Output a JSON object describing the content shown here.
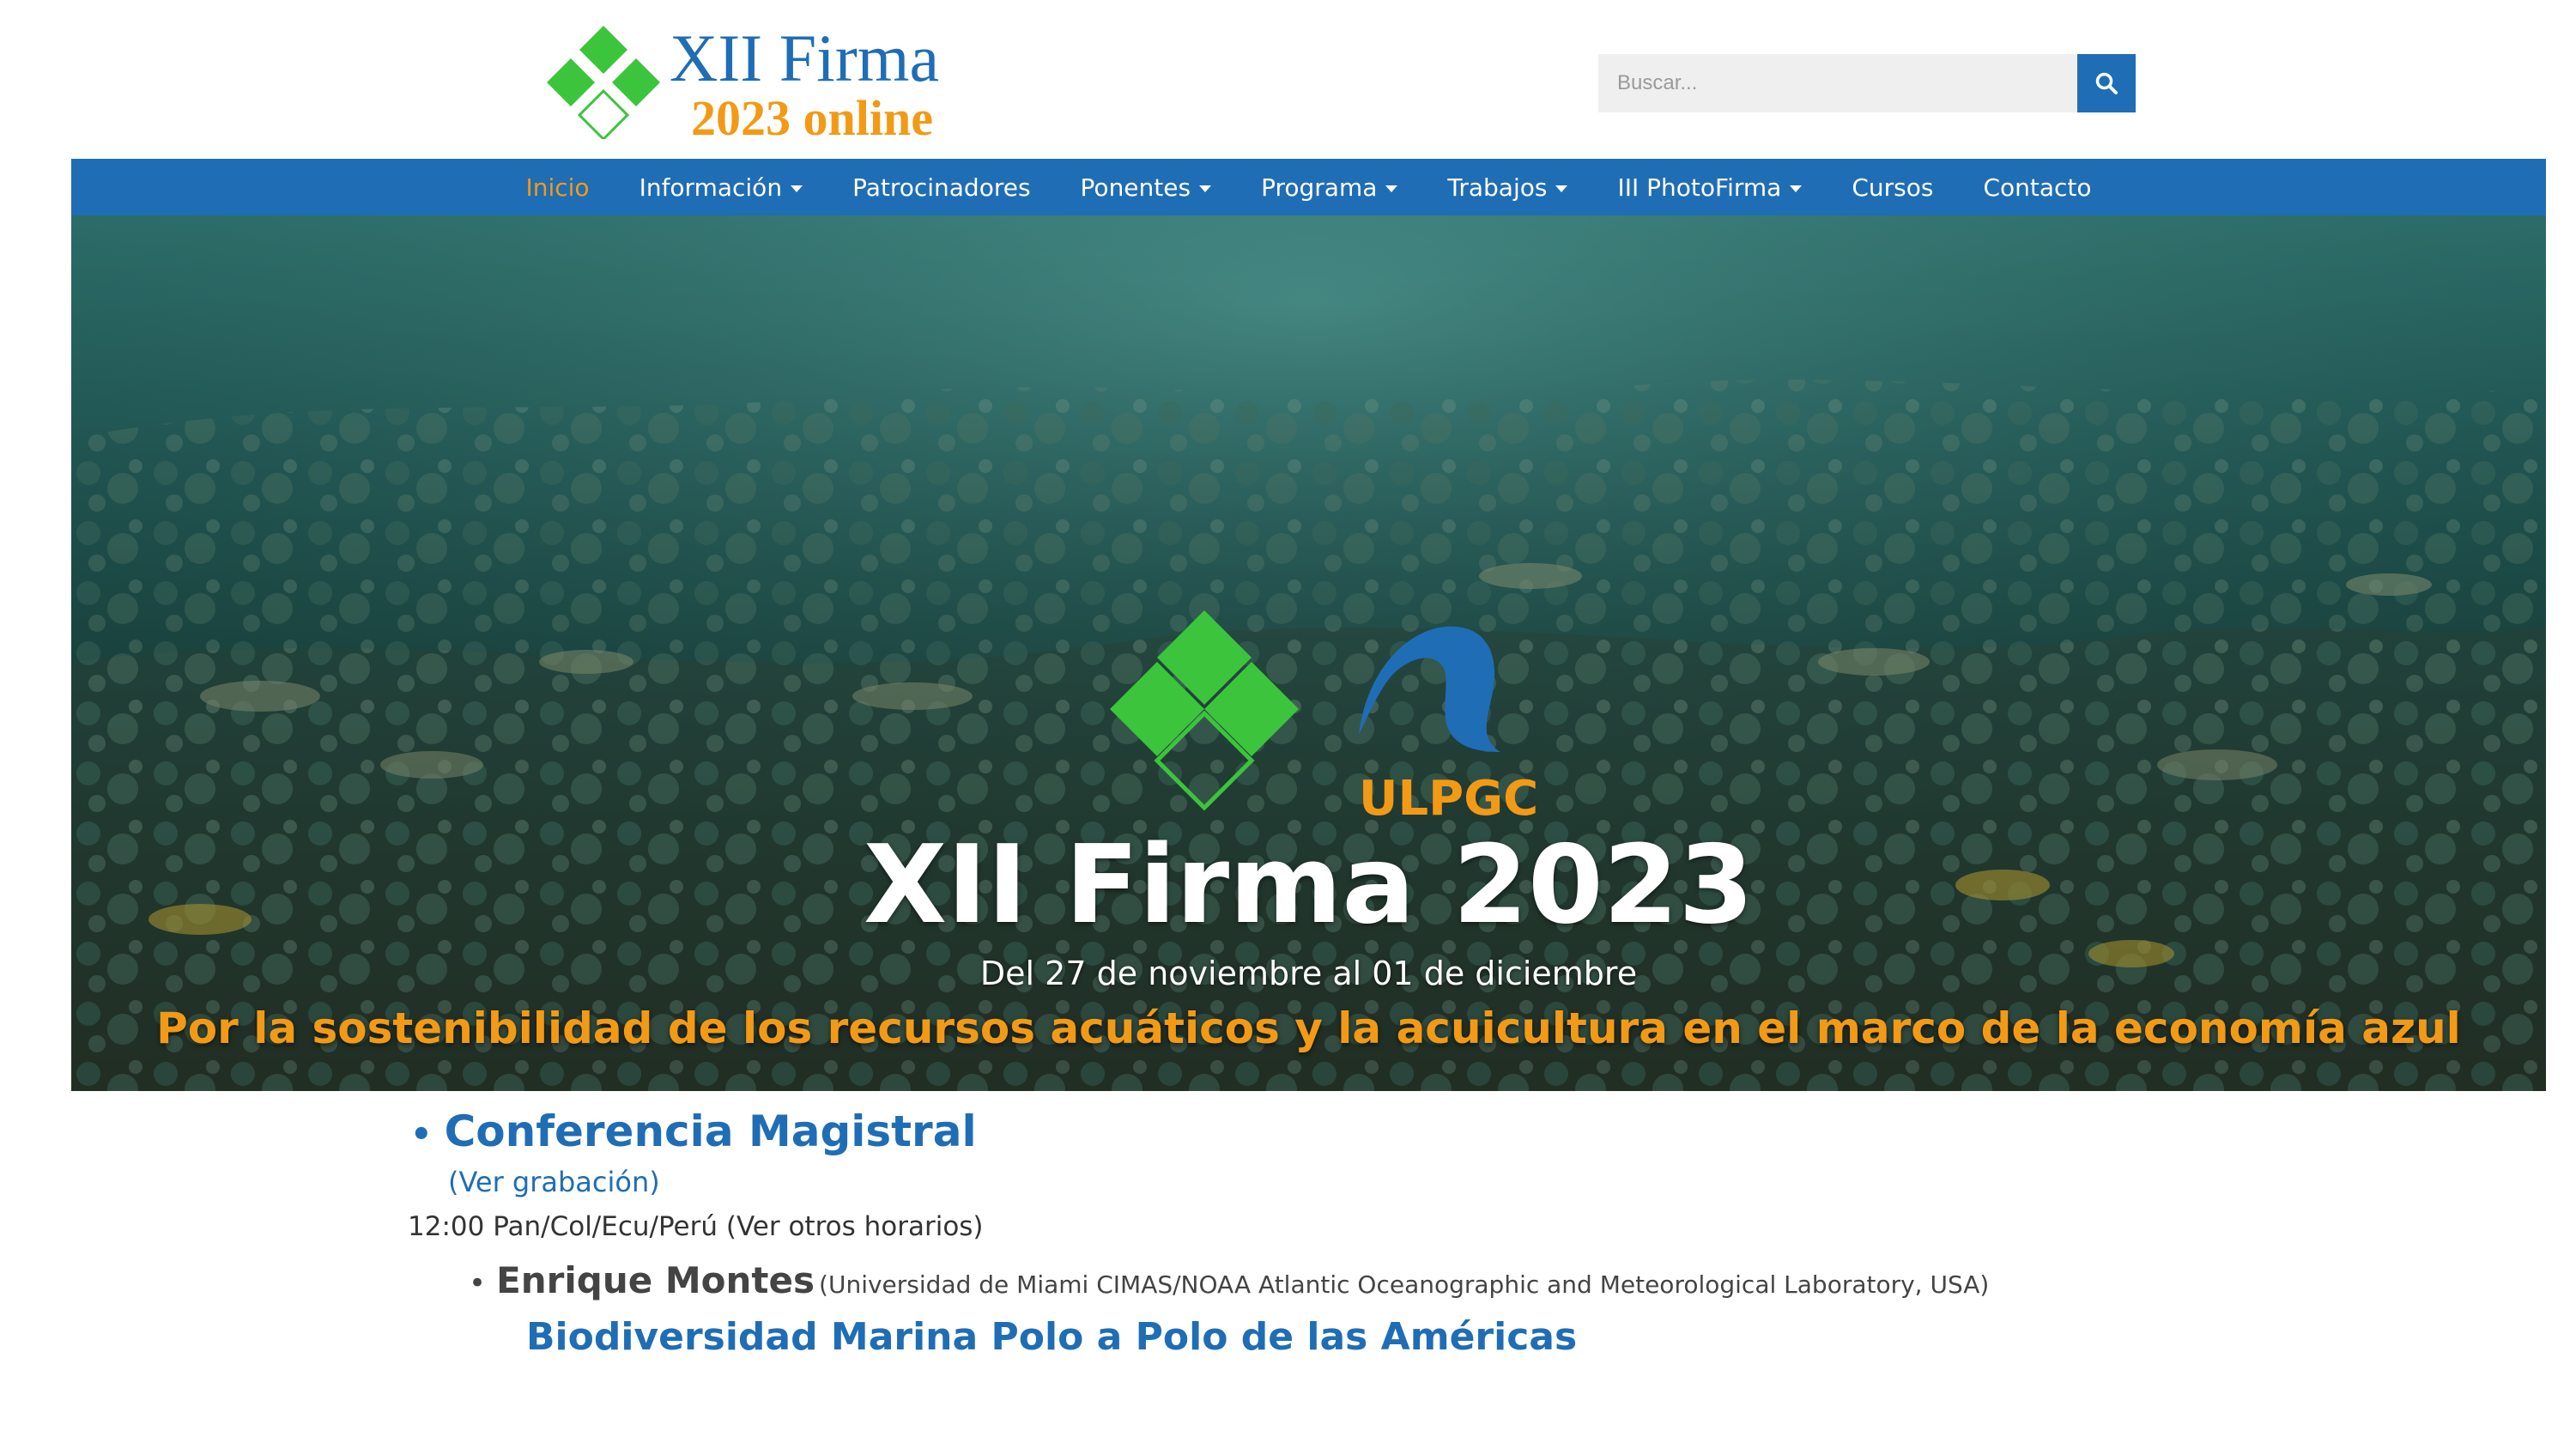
{
  "header": {
    "logo_line1": "XII Firma",
    "logo_line2": "2023 online",
    "search_placeholder": "Buscar..."
  },
  "nav": {
    "items": [
      {
        "label": "Inicio",
        "active": true,
        "dropdown": false
      },
      {
        "label": "Información",
        "active": false,
        "dropdown": true
      },
      {
        "label": "Patrocinadores",
        "active": false,
        "dropdown": false
      },
      {
        "label": "Ponentes",
        "active": false,
        "dropdown": true
      },
      {
        "label": "Programa",
        "active": false,
        "dropdown": true
      },
      {
        "label": "Trabajos",
        "active": false,
        "dropdown": true
      },
      {
        "label": "III PhotoFirma",
        "active": false,
        "dropdown": true
      },
      {
        "label": "Cursos",
        "active": false,
        "dropdown": false
      },
      {
        "label": "Contacto",
        "active": false,
        "dropdown": false
      }
    ]
  },
  "hero": {
    "partner_logo_text": "ULPGC",
    "title": "XII Firma 2023",
    "dates": "Del 27 de noviembre al 01 de diciembre",
    "tagline": "Por la sostenibilidad de los recursos acuáticos y la acuicultura en el marco de la economía azul"
  },
  "content": {
    "bullet": "•",
    "conference_heading": "Conferencia Magistral",
    "recording_link": "(Ver grabación)",
    "time": "12:00 Pan/Col/Ecu/Perú (Ver otros horarios)",
    "speaker_name": "Enrique Montes",
    "speaker_affiliation": "(Universidad de Miami CIMAS/NOAA Atlantic Oceanographic and Meteorological Laboratory, USA)",
    "talk_title": "Biodiversidad Marina Polo a Polo de las Américas"
  },
  "colors": {
    "brand_blue": "#1f6db5",
    "accent_orange": "#f29a16",
    "logo_green": "#3cc43c"
  }
}
